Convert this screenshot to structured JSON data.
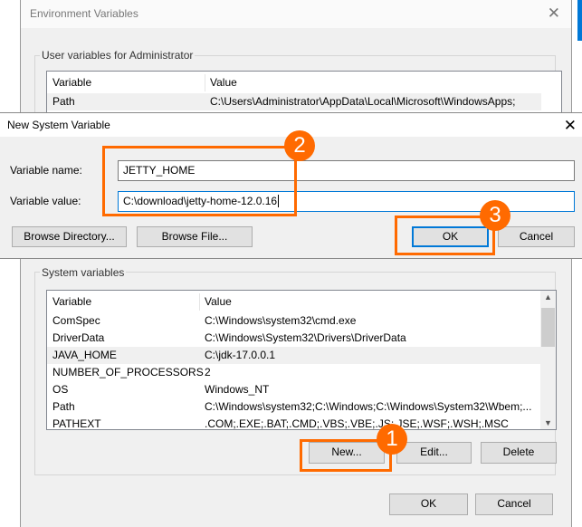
{
  "env_window": {
    "title": "Environment Variables",
    "user_group": "User variables for Administrator",
    "user_columns": [
      "Variable",
      "Value"
    ],
    "user_rows": [
      {
        "var": "Path",
        "value": "C:\\Users\\Administrator\\AppData\\Local\\Microsoft\\WindowsApps;"
      }
    ],
    "system_group": "System variables",
    "system_columns": [
      "Variable",
      "Value"
    ],
    "system_rows": [
      {
        "var": "ComSpec",
        "value": "C:\\Windows\\system32\\cmd.exe"
      },
      {
        "var": "DriverData",
        "value": "C:\\Windows\\System32\\Drivers\\DriverData"
      },
      {
        "var": "JAVA_HOME",
        "value": "C:\\jdk-17.0.0.1"
      },
      {
        "var": "NUMBER_OF_PROCESSORS",
        "value": "2"
      },
      {
        "var": "OS",
        "value": "Windows_NT"
      },
      {
        "var": "Path",
        "value": "C:\\Windows\\system32;C:\\Windows;C:\\Windows\\System32\\Wbem;..."
      },
      {
        "var": "PATHEXT",
        "value": ".COM;.EXE;.BAT;.CMD;.VBS;.VBE;.JS;.JSE;.WSF;.WSH;.MSC"
      }
    ],
    "new_label": "New...",
    "edit_label": "Edit...",
    "delete_label": "Delete",
    "ok_label": "OK",
    "cancel_label": "Cancel"
  },
  "dialog": {
    "title": "New System Variable",
    "name_label": "Variable name:",
    "name_value": "JETTY_HOME",
    "value_label": "Variable value:",
    "value_value": "C:\\download\\jetty-home-12.0.16",
    "browse_dir": "Browse Directory...",
    "browse_file": "Browse File...",
    "ok": "OK",
    "cancel": "Cancel"
  },
  "annotations": [
    "1",
    "2",
    "3"
  ],
  "colors": {
    "annotation": "#ff6a00",
    "focus": "#0078d7"
  }
}
